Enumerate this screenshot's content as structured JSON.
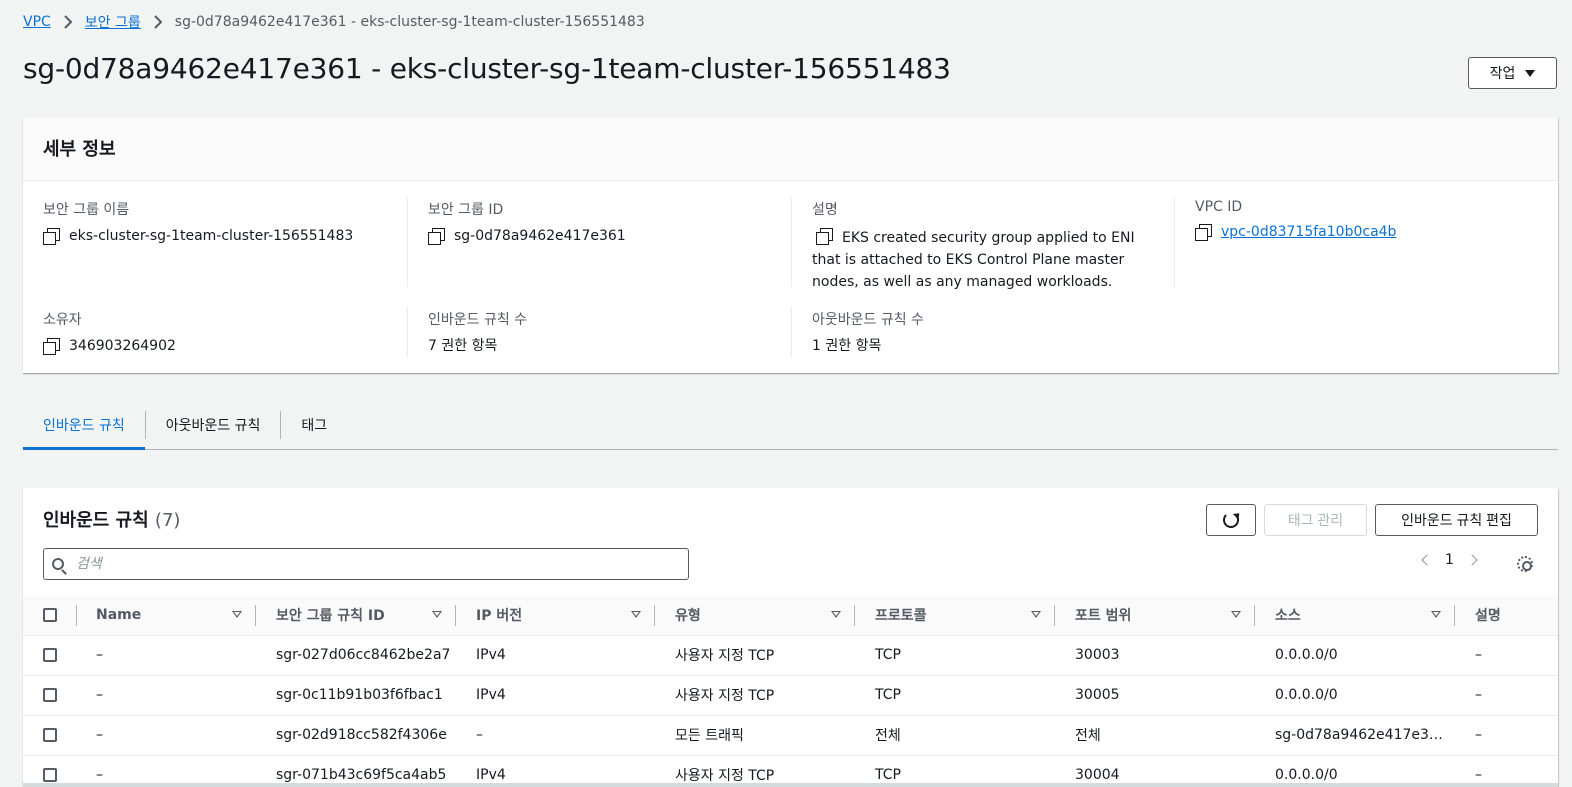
{
  "breadcrumb": {
    "vpc": "VPC",
    "security_groups": "보안 그룹",
    "current": "sg-0d78a9462e417e361 - eks-cluster-sg-1team-cluster-156551483"
  },
  "page_title": "sg-0d78a9462e417e361 - eks-cluster-sg-1team-cluster-156551483",
  "actions_label": "작업",
  "details": {
    "title": "세부 정보",
    "sg_name_label": "보안 그룹 이름",
    "sg_name_value": "eks-cluster-sg-1team-cluster-156551483",
    "sg_id_label": "보안 그룹 ID",
    "sg_id_value": "sg-0d78a9462e417e361",
    "description_label": "설명",
    "description_value": "EKS created security group applied to ENI that is attached to EKS Control Plane master nodes, as well as any managed workloads.",
    "vpc_id_label": "VPC ID",
    "vpc_id_value": "vpc-0d83715fa10b0ca4b",
    "owner_label": "소유자",
    "owner_value": "346903264902",
    "inbound_count_label": "인바운드 규칙 수",
    "inbound_count_value": "7 권한 항목",
    "outbound_count_label": "아웃바운드 규칙 수",
    "outbound_count_value": "1 권한 항목"
  },
  "tabs": [
    "인바운드 규칙",
    "아웃바운드 규칙",
    "태그"
  ],
  "rules": {
    "title": "인바운드 규칙",
    "count": "(7)",
    "manage_tags": "태그 관리",
    "edit_inbound": "인바운드 규칙 편집",
    "search_placeholder": "검색",
    "page": "1",
    "columns": [
      "Name",
      "보안 그룹 규칙 ID",
      "IP 버전",
      "유형",
      "프로토콜",
      "포트 범위",
      "소스",
      "설명"
    ],
    "rows": [
      [
        "–",
        "sgr-027d06cc8462be2a7",
        "IPv4",
        "사용자 지정 TCP",
        "TCP",
        "30003",
        "0.0.0.0/0",
        "–"
      ],
      [
        "–",
        "sgr-0c11b91b03f6fbac1",
        "IPv4",
        "사용자 지정 TCP",
        "TCP",
        "30005",
        "0.0.0.0/0",
        "–"
      ],
      [
        "–",
        "sgr-02d918cc582f4306e",
        "–",
        "모든 트래픽",
        "전체",
        "전체",
        "sg-0d78a9462e417e3…",
        "–"
      ],
      [
        "–",
        "sgr-071b43c69f5ca4ab5",
        "IPv4",
        "사용자 지정 TCP",
        "TCP",
        "30004",
        "0.0.0.0/0",
        "–"
      ]
    ]
  }
}
